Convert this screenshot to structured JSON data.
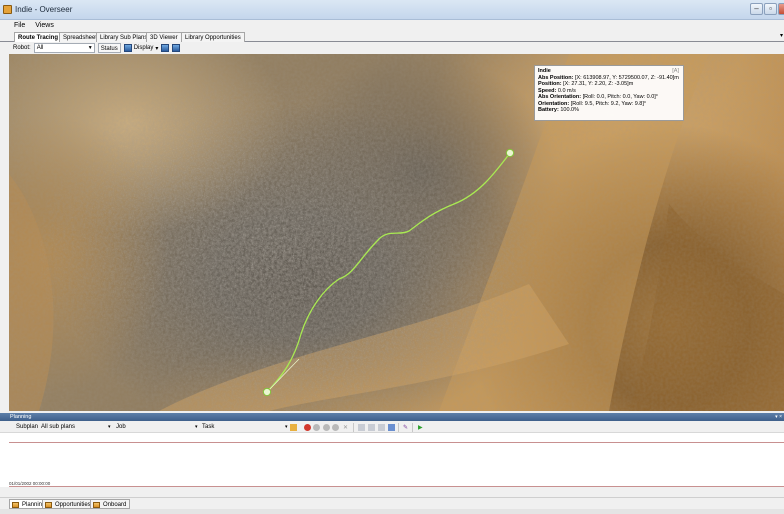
{
  "window": {
    "title": "Indie - Overseer"
  },
  "menu": {
    "items": [
      "File",
      "Views"
    ]
  },
  "tabs": [
    "Route Tracing",
    "Spreadsheet",
    "Library Sub Plans",
    "3D Viewer",
    "Library Opportunities"
  ],
  "toolbar": {
    "robot_label": "Robot:",
    "robot_value": "All",
    "status_label": "Status",
    "display_label": "Display"
  },
  "robot_info": {
    "name": "Indie",
    "badge": "[A]",
    "abs_position_label": "Abs Position:",
    "abs_position_value": "[X: 613908.97, Y: 5729500.07, Z: -91.40]m",
    "position_label": "Position:",
    "position_value": "[X: 27.31, Y: 2.20, Z: -3.05]m",
    "speed_label": "Speed:",
    "speed_value": "0.0 m/s",
    "abs_orientation_label": "Abs Orientation:",
    "abs_orientation_value": "[Roll: 0.0, Pitch: 0.0, Yaw: 0.0]°",
    "orientation_label": "Orientation:",
    "orientation_value": "[Roll: 9.5, Pitch: 9.2, Yaw: 9.8]°",
    "battery_label": "Battery:",
    "battery_value": "100.0%"
  },
  "planning": {
    "header": "Planning",
    "subplan_label": "Subplan",
    "subplan_value": "All sub plans",
    "job_label": "Job",
    "task_label": "Task",
    "date": "01/01/2002 00:00:00"
  },
  "bottom_tabs": [
    "Planning",
    "Opportunities",
    "Onboard"
  ],
  "colors": {
    "route": "#a9ea52",
    "accent": "#3e5f8a"
  }
}
